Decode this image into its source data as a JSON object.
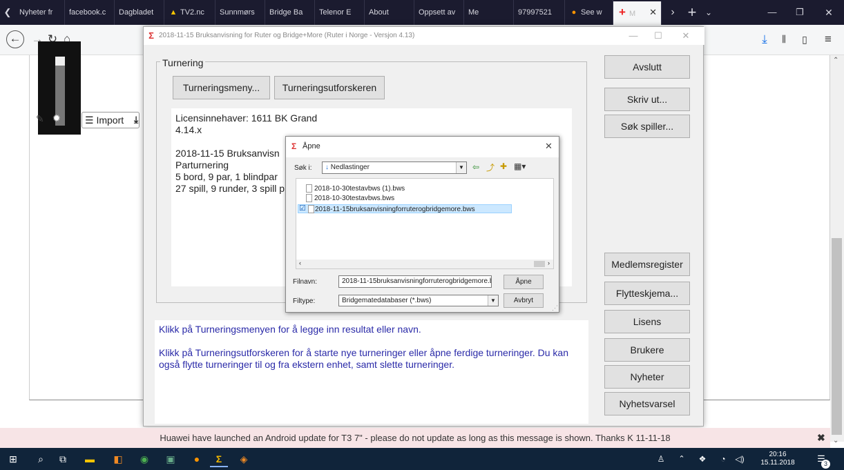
{
  "browser": {
    "tabs": [
      {
        "label": "Nyheter fr"
      },
      {
        "label": "facebook.c"
      },
      {
        "label": "Dagbladet"
      },
      {
        "label": "TV2.nc"
      },
      {
        "label": "Sunnmørs"
      },
      {
        "label": "Bridge Ba"
      },
      {
        "label": "Telenor E"
      },
      {
        "label": "About"
      },
      {
        "label": "Oppsett av"
      },
      {
        "label": "Me"
      },
      {
        "label": "97997521"
      },
      {
        "label": "See w"
      },
      {
        "label": "M"
      }
    ]
  },
  "page": {
    "import_label": "Import"
  },
  "app": {
    "title": "2018-11-15  Bruksanvisning for Ruter og Bridge+More  (Ruter i Norge - Versjon 4.13)",
    "group_label": "Turnering",
    "buttons": {
      "tournament_menu": "Turneringsmeny...",
      "tournament_explorer": "Turneringsutforskeren",
      "exit": "Avslutt",
      "print": "Skriv ut...",
      "search_player": "Søk spiller...",
      "member_register": "Medlemsregister",
      "move_schedule": "Flytteskjema...",
      "license": "Lisens",
      "users": "Brukere",
      "news": "Nyheter",
      "news_alert": "Nyhetsvarsel"
    },
    "info": {
      "licensee": "Licensinnehaver: 1611 BK Grand",
      "version": "4.14.x",
      "tournament_title": "2018-11-15  Bruksanvisn",
      "tournament_type": "Parturnering",
      "tables": "5 bord, 9 par, 1 blindpar",
      "games": "27 spill, 9 runder, 3 spill p"
    },
    "messages": {
      "line1": "Klikk på Turneringsmenyen for å legge inn resultat eller navn.",
      "line2": "Klikk på Turneringsutforskeren for å starte nye turneringer eller åpne ferdige turneringer. Du kan også flytte turneringer til og fra ekstern enhet, samt slette turneringer."
    }
  },
  "dialog": {
    "title": "Åpne",
    "look_in_label": "Søk i:",
    "look_in_value": "Nedlastinger",
    "files": [
      {
        "name": "2018-10-30testavbws (1).bws"
      },
      {
        "name": "2018-10-30testavbws.bws"
      },
      {
        "name": "2018-11-15bruksanvisningforruterogbridgemore.bws"
      }
    ],
    "filename_label": "Filnavn:",
    "filename_value": "2018-11-15bruksanvisningforruterogbridgemore.b",
    "filetype_label": "Filtype:",
    "filetype_value": "Bridgematedatabaser (*.bws)",
    "open_label": "Åpne",
    "cancel_label": "Avbryt"
  },
  "notification": {
    "text": "Huawei have launched an Android update for T3 7\" - please do not update as long as this message is shown. Thanks K 11-11-18"
  },
  "taskbar": {
    "time": "20:16",
    "date": "15.11.2018",
    "notification_count": "3"
  },
  "colors": {
    "tabbar": "#1b1b2f",
    "taskbar": "#10243a",
    "notification_bg": "#f7e4e6",
    "message_text": "#2a2aa8",
    "selection": "#cce8ff"
  }
}
